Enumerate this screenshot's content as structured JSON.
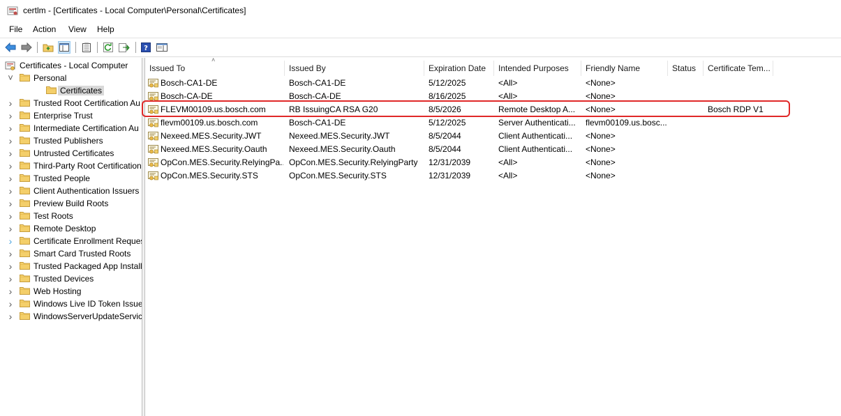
{
  "window": {
    "title": "certlm - [Certificates - Local Computer\\Personal\\Certificates]"
  },
  "menu": [
    "File",
    "Action",
    "View",
    "Help"
  ],
  "toolbar": {
    "icons": [
      "back-arrow-icon",
      "forward-arrow-icon",
      "up-folder-icon",
      "show-hide-tree-icon",
      "properties-icon",
      "refresh-icon",
      "export-list-icon",
      "help-icon",
      "action-pane-icon"
    ]
  },
  "tree": {
    "root": "Certificates - Local Computer",
    "items": [
      {
        "label": "Personal",
        "expanded": true
      },
      {
        "label": "Certificates",
        "selected": true
      },
      {
        "label": "Trusted Root Certification Au"
      },
      {
        "label": "Enterprise Trust"
      },
      {
        "label": "Intermediate Certification Au"
      },
      {
        "label": "Trusted Publishers"
      },
      {
        "label": "Untrusted Certificates"
      },
      {
        "label": "Third-Party Root Certification"
      },
      {
        "label": "Trusted People"
      },
      {
        "label": "Client Authentication Issuers"
      },
      {
        "label": "Preview Build Roots"
      },
      {
        "label": "Test Roots"
      },
      {
        "label": "Remote Desktop"
      },
      {
        "label": "Certificate Enrollment Reques"
      },
      {
        "label": "Smart Card Trusted Roots"
      },
      {
        "label": "Trusted Packaged App Installa"
      },
      {
        "label": "Trusted Devices"
      },
      {
        "label": "Web Hosting"
      },
      {
        "label": "Windows Live ID Token Issuer"
      },
      {
        "label": "WindowsServerUpdateService"
      }
    ]
  },
  "list": {
    "columns": [
      "Issued To",
      "Issued By",
      "Expiration Date",
      "Intended Purposes",
      "Friendly Name",
      "Status",
      "Certificate Tem..."
    ],
    "rows": [
      [
        "Bosch-CA1-DE",
        "Bosch-CA1-DE",
        "5/12/2025",
        "<All>",
        "<None>",
        "",
        ""
      ],
      [
        "Bosch-CA-DE",
        "Bosch-CA-DE",
        "8/16/2025",
        "<All>",
        "<None>",
        "",
        ""
      ],
      [
        "FLEVM00109.us.bosch.com",
        "RB IssuingCA RSA G20",
        "8/5/2026",
        "Remote Desktop A...",
        "<None>",
        "",
        "Bosch RDP V1"
      ],
      [
        "flevm00109.us.bosch.com",
        "Bosch-CA1-DE",
        "5/12/2025",
        "Server Authenticati...",
        "flevm00109.us.bosc...",
        "",
        ""
      ],
      [
        "Nexeed.MES.Security.JWT",
        "Nexeed.MES.Security.JWT",
        "8/5/2044",
        "Client Authenticati...",
        "<None>",
        "",
        ""
      ],
      [
        "Nexeed.MES.Security.Oauth",
        "Nexeed.MES.Security.Oauth",
        "8/5/2044",
        "Client Authenticati...",
        "<None>",
        "",
        ""
      ],
      [
        "OpCon.MES.Security.RelyingPa...",
        "OpCon.MES.Security.RelyingParty",
        "12/31/2039",
        "<All>",
        "<None>",
        "",
        ""
      ],
      [
        "OpCon.MES.Security.STS",
        "OpCon.MES.Security.STS",
        "12/31/2039",
        "<All>",
        "<None>",
        "",
        ""
      ]
    ]
  },
  "colors": {
    "highlight": "#e02828",
    "folder": "#f4cf6a",
    "selected_bg": "#d9d9d9"
  }
}
